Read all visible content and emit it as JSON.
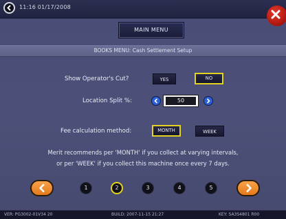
{
  "topbar": {
    "datetime": "11:16  01/17/2008"
  },
  "main_menu_label": "MAIN MENU",
  "subtitle": "BOOKS MENU: Cash Settlement Setup",
  "operators_cut": {
    "label": "Show Operator's Cut?",
    "options": [
      "YES",
      "NO"
    ],
    "selected": "NO"
  },
  "location_split": {
    "label": "Location Split %:",
    "value": "50"
  },
  "fee_method": {
    "label": "Fee calculation method:",
    "options": [
      "MONTH",
      "WEEK"
    ],
    "selected": "MONTH"
  },
  "info": {
    "line1": "Merit recommends per 'MONTH' if you collect at varying intervals,",
    "line2": "or per 'WEEK' if you collect this machine once every 7 days."
  },
  "pagination": {
    "pages": [
      "1",
      "2",
      "3",
      "4",
      "5"
    ],
    "current": "2"
  },
  "status": {
    "version": "VER: PG3002-01V34 20",
    "build": "BUILD: 2007-11-15  21:27",
    "key": "KEY: SA3S4801 R00"
  },
  "colors": {
    "background": "#4a4e76",
    "selected_outline": "#e3d21f",
    "nav_arrow": "#f08c2c",
    "spin_button": "#2b61d4",
    "close_button": "#c8241a"
  }
}
